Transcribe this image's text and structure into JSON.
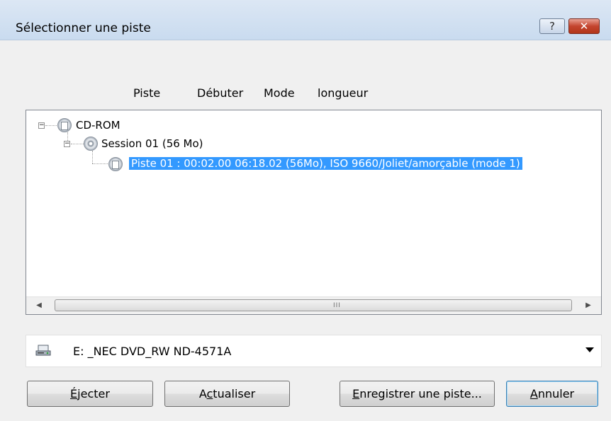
{
  "window": {
    "title": "Sélectionner une piste",
    "help_label": "?",
    "close_label": "✕"
  },
  "columns": [
    "Piste",
    "Débuter",
    "Mode",
    "longueur"
  ],
  "tree": {
    "root": "CD-ROM",
    "session": "Session 01 (56 Mo)",
    "track": "Piste 01 : 00:02.00 06:18.02 (56Mo), ISO 9660/Joliet/amorçable (mode 1)"
  },
  "scroll": {
    "left": "◀",
    "right": "▶",
    "grip": "III"
  },
  "drive": {
    "selected": "E: _NEC DVD_RW ND-4571A",
    "icon": "drive-icon"
  },
  "buttons": {
    "eject": {
      "mnemonic": "É",
      "rest": "jecter"
    },
    "refresh": {
      "pre": "A",
      "mnemonic": "c",
      "rest": "tualiser"
    },
    "save": {
      "mnemonic": "E",
      "rest": "nregistrer une piste..."
    },
    "cancel": {
      "mnemonic": "A",
      "rest": "nnuler"
    }
  }
}
